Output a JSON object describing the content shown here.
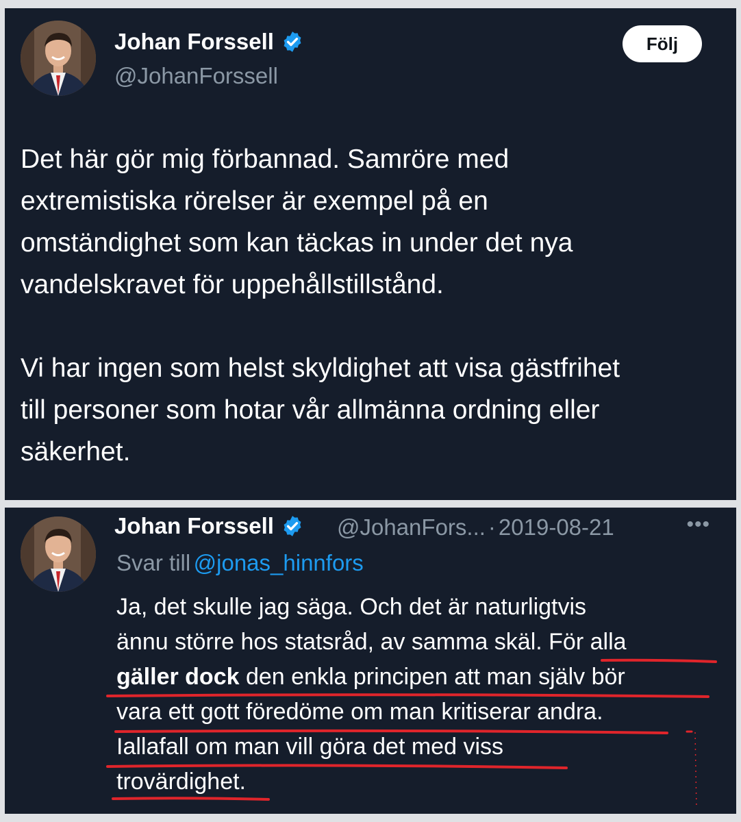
{
  "tweet1": {
    "author": {
      "name": "Johan Forssell",
      "handle": "@JohanForssell",
      "verified_icon": "verified-badge-icon"
    },
    "follow_label": "Följ",
    "paragraphs": [
      [
        "Det här gör mig förbannad. Samröre med",
        "extremistiska rörelser är exempel på en",
        "omständighet som kan täckas in under det nya",
        "vandelskravet för uppehållstillstånd."
      ],
      [
        "Vi har ingen som helst skyldighet att visa gästfrihet",
        "till personer som hotar vår allmänna ordning eller",
        "säkerhet."
      ]
    ]
  },
  "tweet2": {
    "author": {
      "name": "Johan Forssell",
      "handle": "@JohanFors...",
      "verified_icon": "verified-badge-icon"
    },
    "separator": "·",
    "date": "2019-08-21",
    "more_icon": "more-dots-icon",
    "reply_prefix": "Svar till",
    "reply_to": "@jonas_hinnfors",
    "lines": {
      "l1": "Ja, det skulle jag säga. Och det är naturligtvis",
      "l2": "ännu större hos statsråd, av samma skäl. För alla",
      "l3_bold": "gäller dock",
      "l3_rest": " den enkla principen att man själv bör",
      "l4": "vara ett gott föredöme om man kritiserar andra.",
      "l5": "Iallafall om man vill göra det med viss",
      "l6": "trovärdighet."
    }
  },
  "colors": {
    "card_bg": "#151d2b",
    "page_bg": "#dfe1e4",
    "text": "#ffffff",
    "muted": "#8b98a5",
    "link": "#1d9bf0",
    "underline_annotation": "#e0252b"
  }
}
